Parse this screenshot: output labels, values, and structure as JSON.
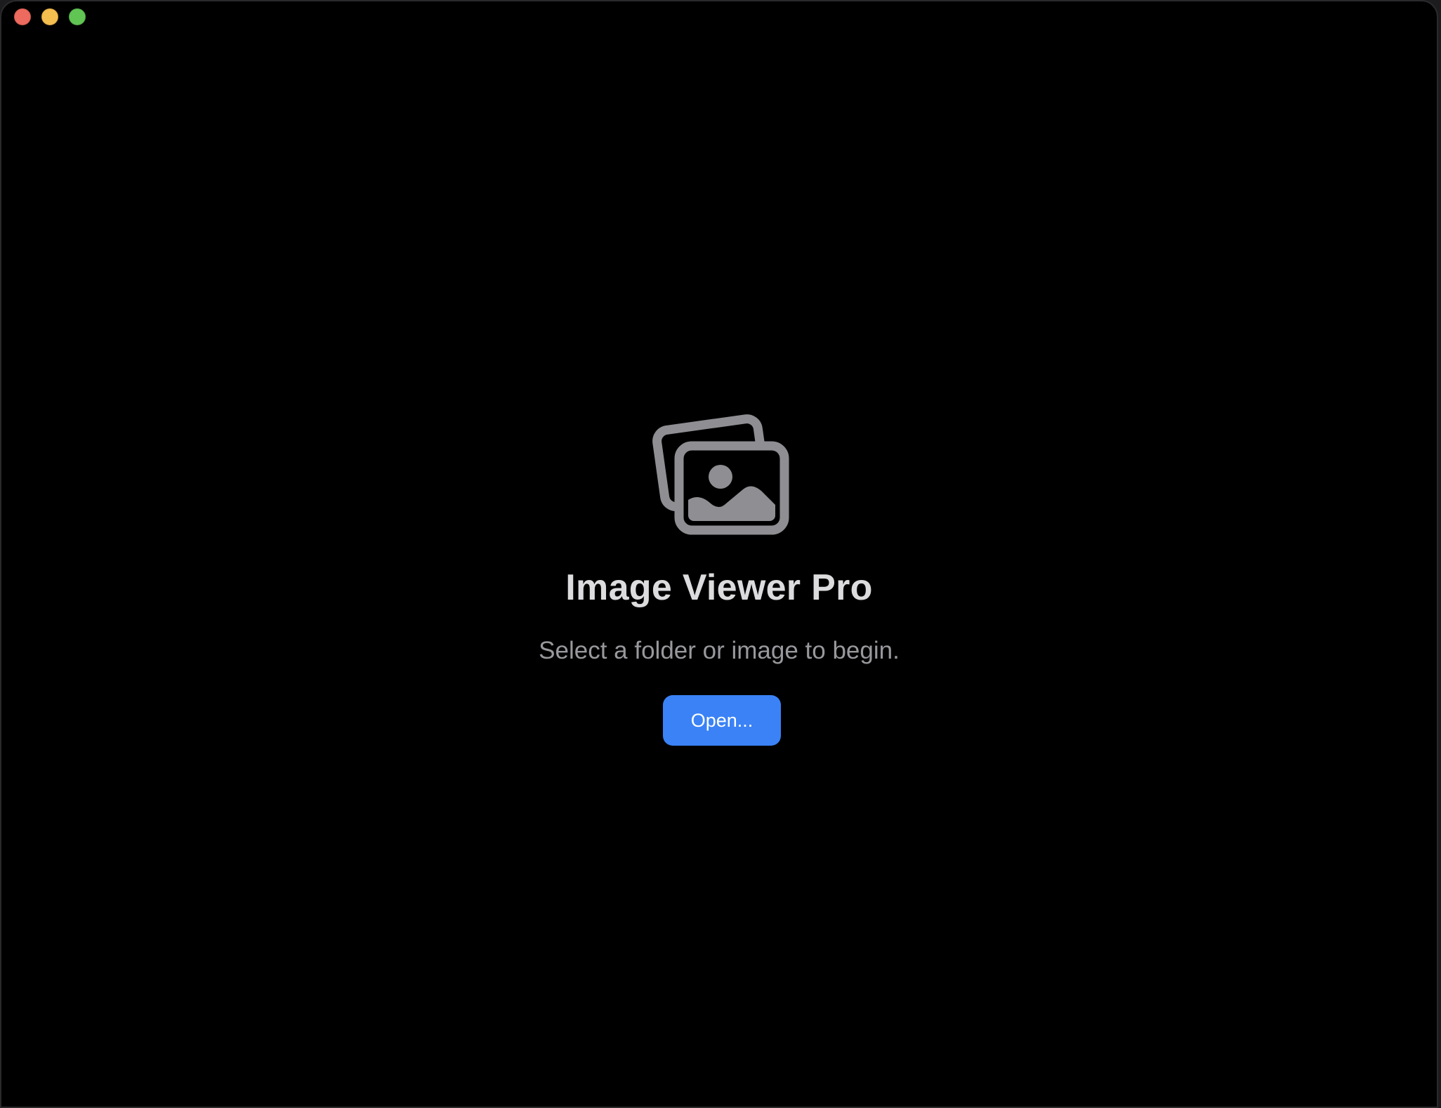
{
  "window": {
    "controls": {
      "close_icon": "close-traffic-light",
      "minimize_icon": "minimize-traffic-light",
      "zoom_icon": "zoom-traffic-light",
      "close_color": "#ed6a5e",
      "minimize_color": "#f5bf4f",
      "zoom_color": "#61c554"
    }
  },
  "empty_state": {
    "icon": "photo-stack-icon",
    "title": "Image Viewer Pro",
    "subtitle": "Select a folder or image to begin.",
    "open_button_label": "Open...",
    "accent_color": "#3a82f6"
  }
}
